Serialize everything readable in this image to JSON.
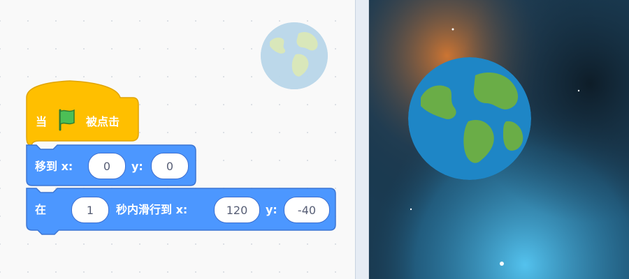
{
  "blocks": {
    "hat": {
      "prefix": "当",
      "flag_icon": "green-flag-icon",
      "suffix": "被点击",
      "color": "#ffbf00"
    },
    "goto": {
      "label": "移到 x:",
      "x_value": "0",
      "y_label": "y:",
      "y_value": "0",
      "color": "#4c97ff"
    },
    "glide": {
      "label": "在",
      "seconds": "1",
      "middle_label": "秒内滑行到 x:",
      "x_value": "120",
      "y_label": "y:",
      "y_value": "-40",
      "color": "#4c97ff"
    }
  },
  "sprite": {
    "icon": "earth-icon"
  },
  "colors": {
    "motion": "#4c97ff",
    "events": "#ffbf00",
    "earth_ocean": "#1e86c6",
    "earth_land": "#6aad47"
  }
}
